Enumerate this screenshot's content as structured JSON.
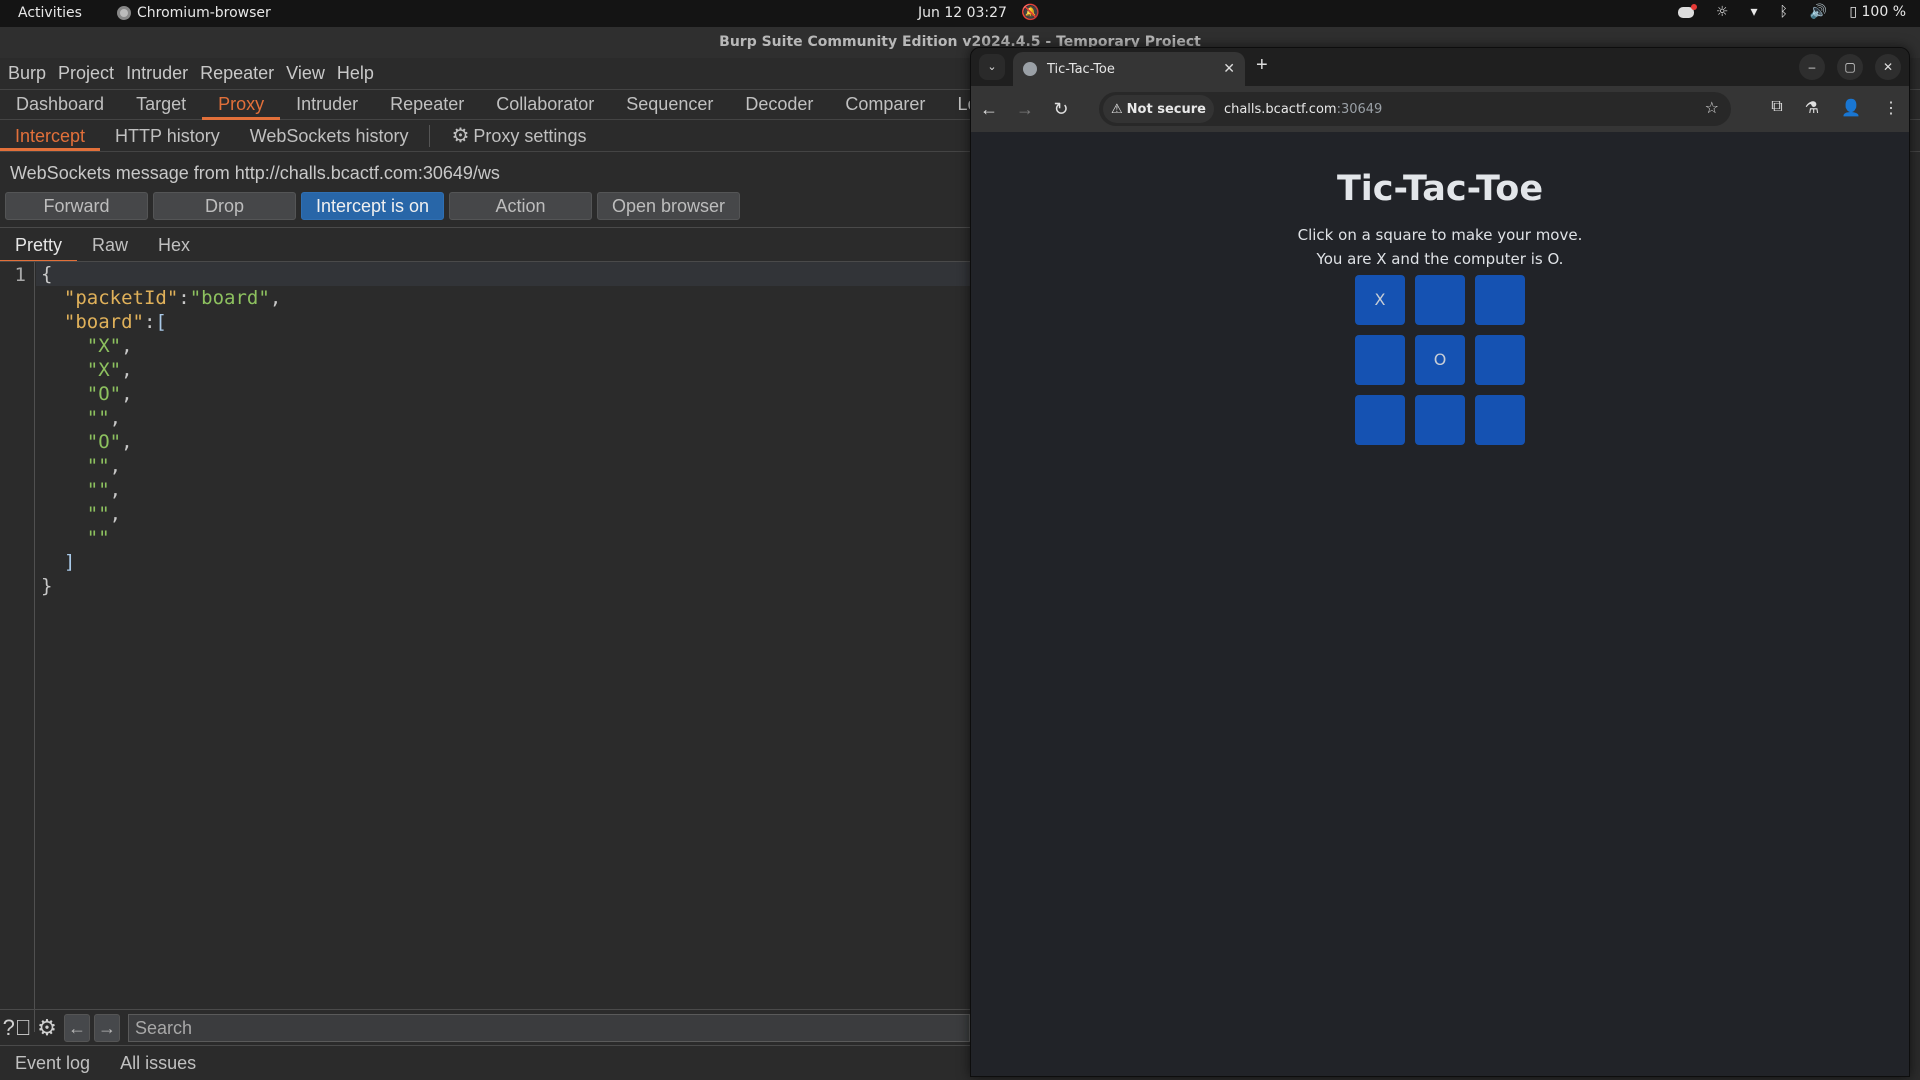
{
  "os_topbar": {
    "activities": "Activities",
    "app_name": "Chromium-browser",
    "clock": "Jun 12  03:27",
    "battery": "100 %"
  },
  "burp": {
    "window_title": "Burp Suite Community Edition v2024.4.5 - Temporary Project",
    "menu": [
      "Burp",
      "Project",
      "Intruder",
      "Repeater",
      "View",
      "Help"
    ],
    "main_tabs": [
      "Dashboard",
      "Target",
      "Proxy",
      "Intruder",
      "Repeater",
      "Collaborator",
      "Sequencer",
      "Decoder",
      "Comparer",
      "Lo"
    ],
    "active_main_tab": "Proxy",
    "sub_tabs": [
      "Intercept",
      "HTTP history",
      "WebSockets history"
    ],
    "active_sub_tab": "Intercept",
    "proxy_settings_label": "Proxy settings",
    "ws_message": "WebSockets message from http://challs.bcactf.com:30649/ws",
    "buttons": {
      "forward": "Forward",
      "drop": "Drop",
      "intercept": "Intercept is on",
      "action": "Action",
      "open_browser": "Open browser"
    },
    "view_tabs": [
      "Pretty",
      "Raw",
      "Hex"
    ],
    "active_view_tab": "Pretty",
    "editor": {
      "line_number": "1",
      "packet_key": "\"packetId\"",
      "packet_value": "\"board\"",
      "board_key": "\"board\"",
      "board_values": [
        "\"X\"",
        "\"X\"",
        "\"O\"",
        "\"\"",
        "\"O\"",
        "\"\"",
        "\"\"",
        "\"\"",
        "\"\""
      ]
    },
    "search_placeholder": "Search",
    "bottom_tabs": [
      "Event log",
      "All issues"
    ]
  },
  "browser": {
    "tab_title": "Tic-Tac-Toe",
    "security_label": "Not secure",
    "url_host": "challs.bcactf.com",
    "url_port": ":30649",
    "page": {
      "title": "Tic-Tac-Toe",
      "instruction1": "Click on a square to make your move.",
      "instruction2": "You are X and the computer is O.",
      "board": [
        "X",
        "",
        "",
        "",
        "O",
        "",
        "",
        "",
        ""
      ]
    }
  }
}
